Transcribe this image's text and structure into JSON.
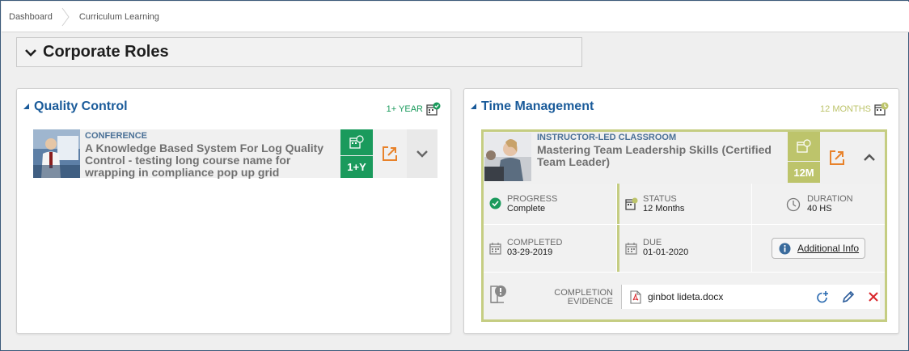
{
  "breadcrumb": {
    "items": [
      "Dashboard",
      "Curriculum Learning"
    ]
  },
  "roles": {
    "title": "Corporate Roles"
  },
  "colors": {
    "accent_blue": "#1a5b9a",
    "green": "#1a9a5c",
    "olive": "#bdc46b",
    "orange": "#e8822a",
    "red": "#d9262b"
  },
  "quality": {
    "title": "Quality Control",
    "badge": "1+ YEAR",
    "course": {
      "type": "CONFERENCE",
      "name": "A Knowledge Based System For Log Quality Control - testing long course name for wrapping in compliance pop up grid",
      "duration_badge": "1+Y"
    }
  },
  "time": {
    "title": "Time Management",
    "badge": "12 MONTHS",
    "course": {
      "type": "INSTRUCTOR-LED CLASSROOM",
      "name": "Mastering Team Leadership Skills (Certified Team Leader)",
      "duration_badge": "12M"
    },
    "details": {
      "progress_label": "PROGRESS",
      "progress_value": "Complete",
      "status_label": "STATUS",
      "status_value": "12 Months",
      "duration_label": "DURATION",
      "duration_value": "40 HS",
      "completed_label": "COMPLETED",
      "completed_value": "03-29-2019",
      "due_label": "DUE",
      "due_value": "01-01-2020",
      "additional_info": "Additional Info",
      "evidence_label_line1": "COMPLETION",
      "evidence_label_line2": "EVIDENCE",
      "evidence_file": "ginbot lideta.docx"
    }
  }
}
